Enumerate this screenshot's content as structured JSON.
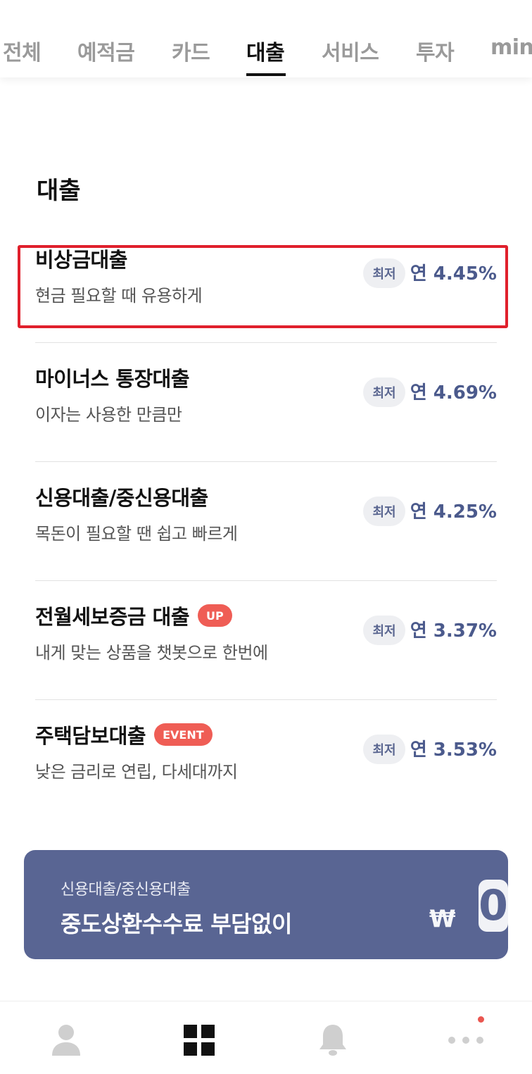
{
  "tabs": [
    {
      "label": "전체",
      "active": false
    },
    {
      "label": "예적금",
      "active": false
    },
    {
      "label": "카드",
      "active": false
    },
    {
      "label": "대출",
      "active": true
    },
    {
      "label": "서비스",
      "active": false
    },
    {
      "label": "투자",
      "active": false
    },
    {
      "label": "mini",
      "active": false
    }
  ],
  "section_title": "대출",
  "loans": [
    {
      "name": "비상금대출",
      "desc": "현금 필요할 때 유용하게",
      "min_label": "최저",
      "rate": "연 4.45%",
      "tag": "",
      "highlighted": true
    },
    {
      "name": "마이너스 통장대출",
      "desc": "이자는 사용한 만큼만",
      "min_label": "최저",
      "rate": "연 4.69%",
      "tag": ""
    },
    {
      "name": "신용대출/중신용대출",
      "desc": "목돈이 필요할 땐 쉽고 빠르게",
      "min_label": "최저",
      "rate": "연 4.25%",
      "tag": ""
    },
    {
      "name": "전월세보증금 대출",
      "desc": "내게 맞는 상품을 챗봇으로 한번에",
      "min_label": "최저",
      "rate": "연 3.37%",
      "tag": "UP"
    },
    {
      "name": "주택담보대출",
      "desc": "낮은 금리로 연립, 다세대까지",
      "min_label": "최저",
      "rate": "연 3.53%",
      "tag": "EVENT"
    }
  ],
  "banner": {
    "subtitle": "신용대출/중신용대출",
    "title": "중도상환수수료 부담없이",
    "currency": "₩",
    "amount": "0"
  },
  "bottom_nav": [
    {
      "icon": "person-icon"
    },
    {
      "icon": "grid-icon",
      "active": true
    },
    {
      "icon": "bell-icon"
    },
    {
      "icon": "more-dots-icon",
      "notification": true
    }
  ],
  "colors": {
    "accent": "#596593",
    "rate": "#4b5a8c",
    "tag": "#ef5d55",
    "highlight_border": "#e0202c"
  }
}
